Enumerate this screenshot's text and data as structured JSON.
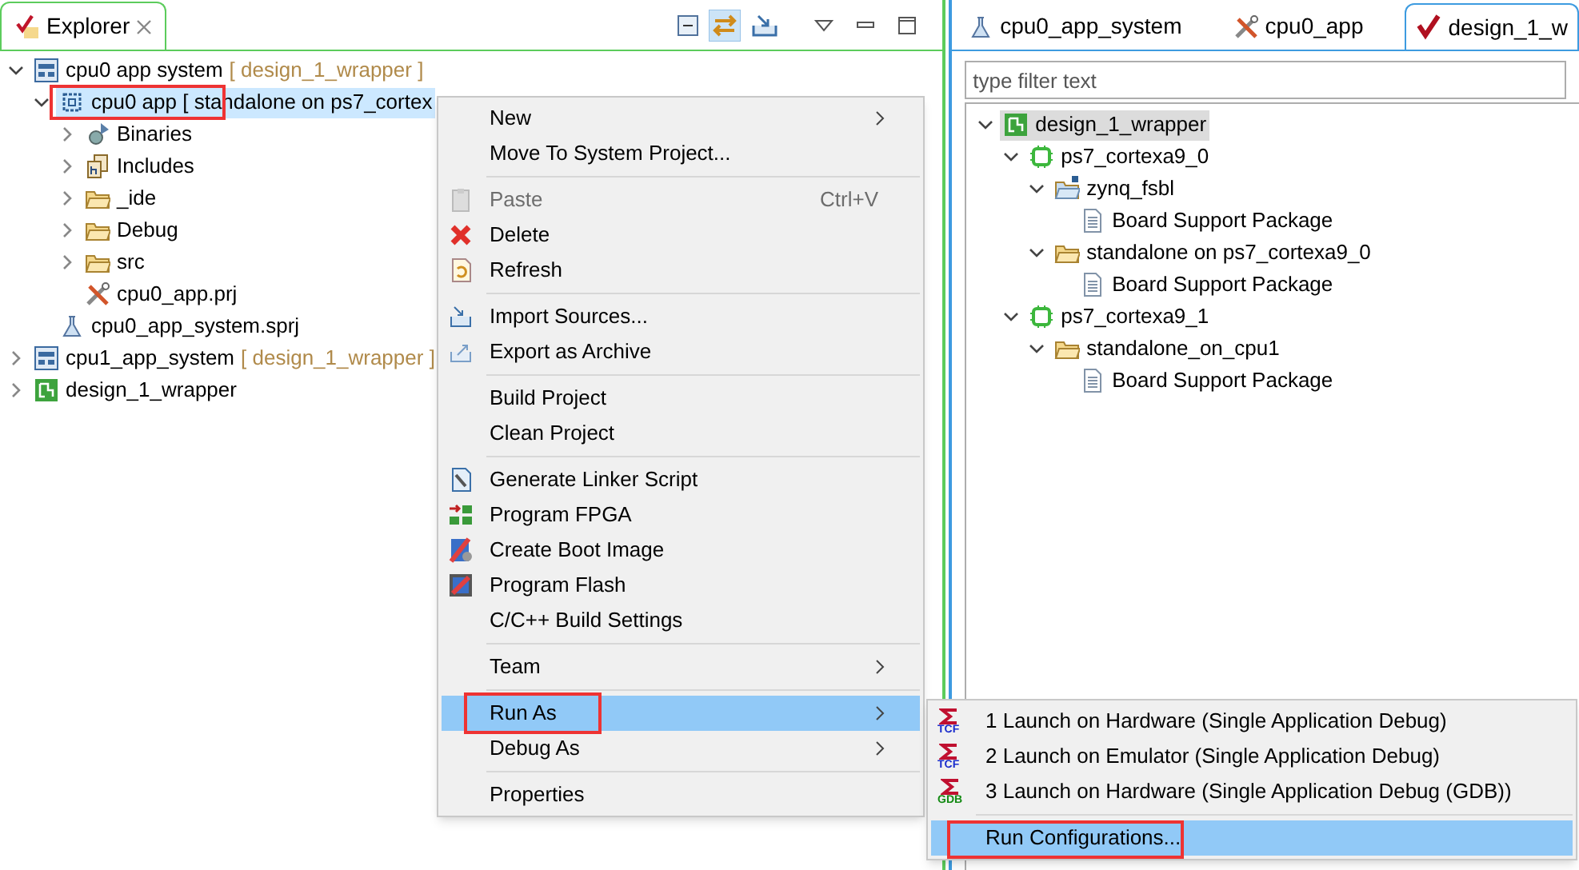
{
  "explorer": {
    "tab": {
      "title": "Explorer"
    },
    "tree": [
      {
        "label": "cpu0 app system",
        "suffix": "[ design_1_wrapper ]",
        "kind": "system",
        "expanded": true,
        "selected": false,
        "children": [
          {
            "label": "cpu0 app [ standalone on ps7_cortex",
            "kind": "app",
            "expanded": true,
            "selected": true,
            "children": [
              {
                "label": "Binaries",
                "kind": "binaries",
                "expanded": false,
                "selected": false
              },
              {
                "label": "Includes",
                "kind": "includes",
                "expanded": false,
                "selected": false
              },
              {
                "label": "_ide",
                "kind": "folder",
                "expanded": false,
                "selected": false
              },
              {
                "label": "Debug",
                "kind": "folder",
                "expanded": false,
                "selected": false
              },
              {
                "label": "src",
                "kind": "folder",
                "expanded": false,
                "selected": false
              },
              {
                "label": "cpu0_app.prj",
                "kind": "prj",
                "selected": false
              }
            ]
          },
          {
            "label": "cpu0_app_system.sprj",
            "kind": "sprj",
            "selected": false
          }
        ]
      },
      {
        "label": "cpu1_app_system",
        "suffix": "[ design_1_wrapper ]",
        "kind": "system",
        "expanded": false,
        "selected": false
      },
      {
        "label": "design_1_wrapper",
        "kind": "hw",
        "expanded": false,
        "selected": false
      }
    ]
  },
  "editor": {
    "tabs": [
      {
        "label": "cpu0_app_system",
        "selected": false
      },
      {
        "label": "cpu0_app",
        "selected": false
      },
      {
        "label": "design_1_w",
        "selected": true
      }
    ],
    "filter": {
      "placeholder": "type filter text"
    },
    "tree": [
      {
        "label": "design_1_wrapper",
        "kind": "hw",
        "expanded": true,
        "selected": true,
        "children": [
          {
            "label": "ps7_cortexa9_0",
            "kind": "cpu",
            "expanded": true,
            "selected": false,
            "children": [
              {
                "label": "zynq_fsbl",
                "kind": "bspfolder",
                "expanded": true,
                "selected": false,
                "children": [
                  {
                    "label": "Board Support Package",
                    "kind": "doc",
                    "selected": false
                  }
                ]
              },
              {
                "label": "standalone on ps7_cortexa9_0",
                "kind": "folder",
                "expanded": true,
                "selected": false,
                "children": [
                  {
                    "label": "Board Support Package",
                    "kind": "doc",
                    "selected": false
                  }
                ]
              }
            ]
          },
          {
            "label": "ps7_cortexa9_1",
            "kind": "cpu",
            "expanded": true,
            "selected": false,
            "children": [
              {
                "label": "standalone_on_cpu1",
                "kind": "folder",
                "expanded": true,
                "selected": false,
                "children": [
                  {
                    "label": "Board Support Package",
                    "kind": "doc",
                    "selected": false
                  }
                ]
              }
            ]
          }
        ]
      }
    ]
  },
  "context_menu": [
    {
      "kind": "item",
      "label": "New",
      "submenu": true,
      "disabled": false,
      "selected": false
    },
    {
      "kind": "item",
      "label": "Move To System Project...",
      "disabled": false,
      "selected": false
    },
    {
      "kind": "separator"
    },
    {
      "kind": "item",
      "label": "Paste",
      "shortcut": "Ctrl+V",
      "disabled": true,
      "selected": false
    },
    {
      "kind": "item",
      "label": "Delete",
      "disabled": false,
      "selected": false
    },
    {
      "kind": "item",
      "label": "Refresh",
      "disabled": false,
      "selected": false
    },
    {
      "kind": "separator"
    },
    {
      "kind": "item",
      "label": "Import Sources...",
      "disabled": false,
      "selected": false
    },
    {
      "kind": "item",
      "label": "Export as Archive",
      "disabled": false,
      "selected": false
    },
    {
      "kind": "separator"
    },
    {
      "kind": "item",
      "label": "Build Project",
      "disabled": false,
      "selected": false
    },
    {
      "kind": "item",
      "label": "Clean Project",
      "disabled": false,
      "selected": false
    },
    {
      "kind": "separator"
    },
    {
      "kind": "item",
      "label": "Generate Linker Script",
      "disabled": false,
      "selected": false
    },
    {
      "kind": "item",
      "label": "Program FPGA",
      "disabled": false,
      "selected": false
    },
    {
      "kind": "item",
      "label": "Create Boot Image",
      "disabled": false,
      "selected": false
    },
    {
      "kind": "item",
      "label": "Program Flash",
      "disabled": false,
      "selected": false
    },
    {
      "kind": "item",
      "label": "C/C++ Build Settings",
      "disabled": false,
      "selected": false
    },
    {
      "kind": "separator"
    },
    {
      "kind": "item",
      "label": "Team",
      "submenu": true,
      "disabled": false,
      "selected": false
    },
    {
      "kind": "separator"
    },
    {
      "kind": "item",
      "label": "Run As",
      "submenu": true,
      "disabled": false,
      "selected": true
    },
    {
      "kind": "item",
      "label": "Debug As",
      "submenu": true,
      "disabled": false,
      "selected": false
    },
    {
      "kind": "separator"
    },
    {
      "kind": "item",
      "label": "Properties",
      "disabled": false,
      "selected": false
    }
  ],
  "run_as_menu": [
    {
      "kind": "item",
      "label": "1 Launch on Hardware (Single Application Debug)",
      "badge": "TCF",
      "selected": false
    },
    {
      "kind": "item",
      "label": "2 Launch on Emulator (Single Application Debug)",
      "badge": "TCF",
      "selected": false
    },
    {
      "kind": "item",
      "label": "3 Launch on Hardware (Single Application Debug (GDB))",
      "badge": "GDB",
      "selected": false
    },
    {
      "kind": "separator"
    },
    {
      "kind": "item",
      "label": "Run Configurations...",
      "selected": true
    }
  ]
}
